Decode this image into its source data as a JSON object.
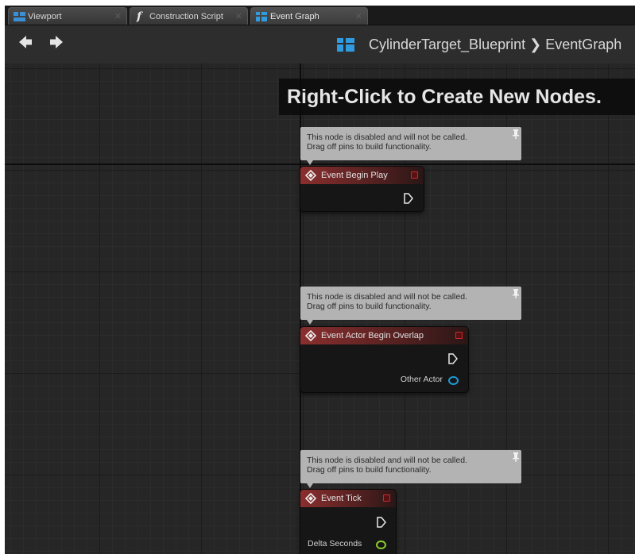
{
  "tabs": [
    {
      "label": "Viewport",
      "icon": "viewport-icon",
      "active": false
    },
    {
      "label": "Construction Script",
      "icon": "function-icon",
      "active": false
    },
    {
      "label": "Event Graph",
      "icon": "event-graph-icon",
      "active": true
    }
  ],
  "toolbar": {
    "back_icon": "arrow-left-icon",
    "forward_icon": "arrow-right-icon",
    "breadcrumb_icon": "event-graph-icon",
    "breadcrumb": "CylinderTarget_Blueprint ❯ EventGraph"
  },
  "graph": {
    "hint": "Right-Click to Create New Nodes.",
    "comment_line1": "This node is disabled and will not be called.",
    "comment_line2": "Drag off pins to build functionality.",
    "nodes": [
      {
        "title": "Event Begin Play",
        "pins": []
      },
      {
        "title": "Event Actor Begin Overlap",
        "pins": [
          {
            "label": "Other Actor",
            "color": "#1e9ad6"
          }
        ]
      },
      {
        "title": "Event Tick",
        "pins": [
          {
            "label": "Delta Seconds",
            "color": "#8ccb2e"
          }
        ]
      }
    ]
  },
  "colors": {
    "event_header": "#8a2e2e",
    "delegate_pin": "#c8282d",
    "object_pin": "#1e9ad6",
    "float_pin": "#8ccb2e",
    "comment_bg": "#b3b3b3",
    "graph_bg": "#262626"
  }
}
